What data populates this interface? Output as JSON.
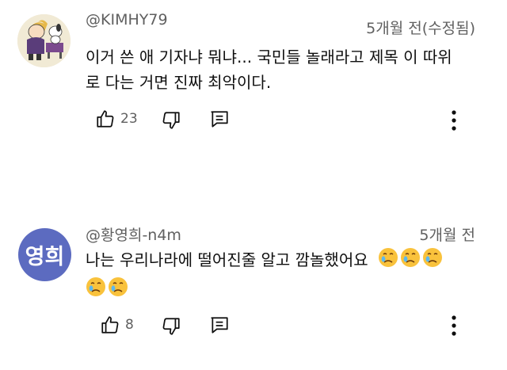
{
  "comments": [
    {
      "author": "@KIMHY79",
      "time": "5개월 전(수정됨)",
      "text_line1": "이거 쓴 애 기자냐 뭐냐... 국민들 놀래라고 제목 이 따위",
      "text_line2": "로 다는 거면 진짜 최악이다.",
      "like_count": "23",
      "avatar_icon": "cartoon-avatar"
    },
    {
      "author": "@황영희-n4m",
      "time": "5개월 전",
      "text_line1": "나는  우리나라에 떨어진줄 알고 깜놀했어요",
      "avatar_text": "영희",
      "avatar_color": "#5c6bc0",
      "like_count": "8",
      "emoji_name": "crying-face-emoji"
    }
  ],
  "colors": {
    "text": "#0f0f0f",
    "meta": "#606060",
    "icon": "#0f0f0f"
  }
}
